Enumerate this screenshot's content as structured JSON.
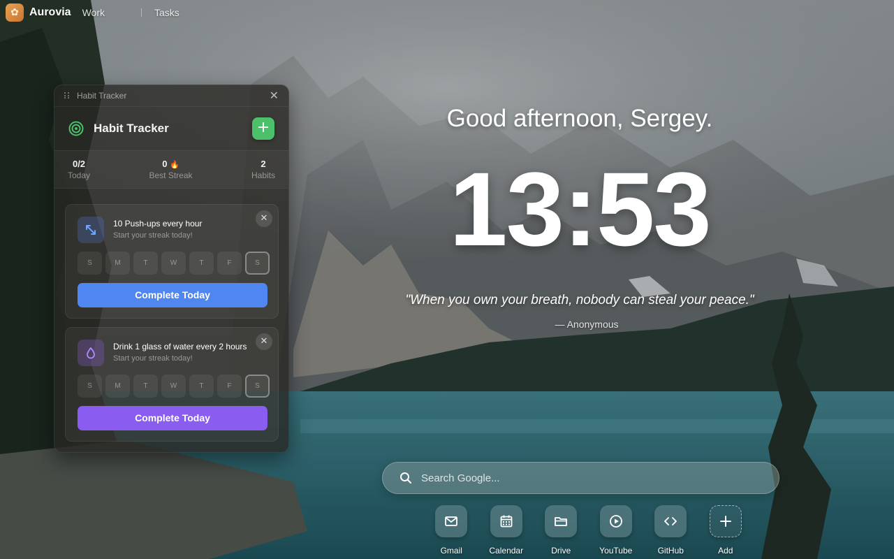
{
  "topbar": {
    "brand": "Aurovia",
    "nav": [
      "Work",
      "Tasks"
    ]
  },
  "widget": {
    "titlebar": "Habit Tracker",
    "heading": "Habit Tracker",
    "stats": [
      {
        "value": "0/2",
        "label": "Today"
      },
      {
        "value": "0",
        "label": "Best Streak"
      },
      {
        "value": "2",
        "label": "Habits"
      }
    ],
    "habits": [
      {
        "title": "10 Push-ups every hour",
        "subtitle": "Start your streak today!",
        "days": [
          "S",
          "M",
          "T",
          "W",
          "T",
          "F",
          "S"
        ],
        "button": "Complete Today",
        "color": "#4f86f0"
      },
      {
        "title": "Drink 1 glass of water every 2 hours",
        "subtitle": "Start your streak today!",
        "days": [
          "S",
          "M",
          "T",
          "W",
          "T",
          "F",
          "S"
        ],
        "button": "Complete Today",
        "color": "#8a5cf0"
      }
    ]
  },
  "center": {
    "greeting": "Good afternoon, Sergey.",
    "clock": "13:53",
    "quote": "\"When you own your breath, nobody can steal your peace.\"",
    "author": "— Anonymous"
  },
  "search": {
    "placeholder": "Search Google..."
  },
  "shortcuts": [
    {
      "label": "Gmail",
      "icon": "mail-icon"
    },
    {
      "label": "Calendar",
      "icon": "calendar-icon"
    },
    {
      "label": "Drive",
      "icon": "folder-icon"
    },
    {
      "label": "YouTube",
      "icon": "play-icon"
    },
    {
      "label": "GitHub",
      "icon": "code-icon"
    },
    {
      "label": "Add",
      "icon": "plus-icon"
    }
  ],
  "colors": {
    "accent_green": "#4cc06a",
    "accent_blue": "#4f86f0",
    "accent_purple": "#8a5cf0",
    "brand_orange": "#e8a055"
  }
}
